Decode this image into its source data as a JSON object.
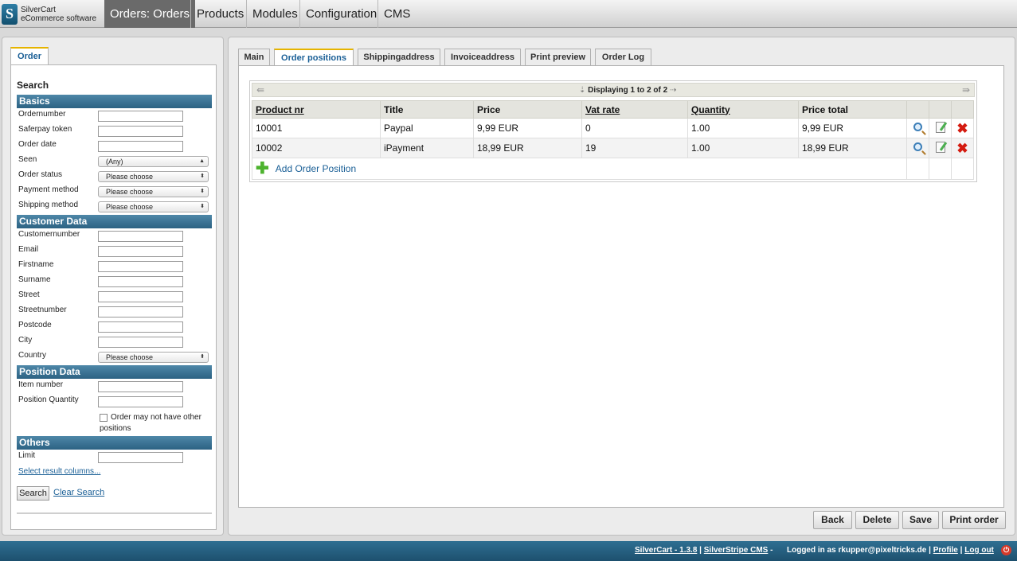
{
  "logo": {
    "line1": "SilverCart",
    "line2": "eCommerce software",
    "mark": "S"
  },
  "nav": [
    {
      "label": "Orders: Orders"
    },
    {
      "label": "Products"
    },
    {
      "label": "Modules"
    },
    {
      "label": "Configuration"
    },
    {
      "label": "CMS"
    }
  ],
  "left": {
    "tab": "Order",
    "search_title": "Search",
    "sections": {
      "basics": "Basics",
      "customer": "Customer Data",
      "position": "Position Data",
      "others": "Others"
    },
    "fields": {
      "ordernumber": "Ordernumber",
      "saferpay": "Saferpay token",
      "order_date": "Order date",
      "seen": "Seen",
      "order_status": "Order status",
      "payment_method": "Payment method",
      "shipping_method": "Shipping method",
      "customernumber": "Customernumber",
      "email": "Email",
      "firstname": "Firstname",
      "surname": "Surname",
      "street": "Street",
      "streetnumber": "Streetnumber",
      "postcode": "Postcode",
      "city": "City",
      "country": "Country",
      "item_number": "Item number",
      "position_quantity": "Position Quantity",
      "limit": "Limit"
    },
    "selects": {
      "seen": "(Any)",
      "order_status": "Please choose",
      "payment_method": "Please choose",
      "shipping_method": "Please choose",
      "country": "Please choose"
    },
    "no_other_positions": "Order may not have other positions",
    "select_columns": "Select result columns...",
    "search_button": "Search",
    "clear_search": "Clear Search"
  },
  "tabs": [
    {
      "label": "Main"
    },
    {
      "label": "Order positions"
    },
    {
      "label": "Shippingaddress"
    },
    {
      "label": "Invoiceaddress"
    },
    {
      "label": "Print preview"
    },
    {
      "label": "Order Log"
    }
  ],
  "pager": {
    "text": "Displaying 1 to 2 of 2"
  },
  "table": {
    "headers": [
      "Product nr",
      "Title",
      "Price",
      "Vat rate",
      "Quantity",
      "Price total"
    ],
    "rows": [
      {
        "product_nr": "10001",
        "title": "Paypal",
        "price": "9,99 EUR",
        "vat": "0",
        "qty": "1.00",
        "total": "9,99 EUR"
      },
      {
        "product_nr": "10002",
        "title": "iPayment",
        "price": "18,99 EUR",
        "vat": "19",
        "qty": "1.00",
        "total": "18,99 EUR"
      }
    ],
    "add_label": "Add Order Position"
  },
  "buttons": {
    "back": "Back",
    "delete": "Delete",
    "save": "Save",
    "print": "Print order"
  },
  "footer": {
    "silvercart": "SilverCart - 1.3.8",
    "sep": "|",
    "silverstripe": "SilverStripe CMS",
    "dash": "-",
    "logged_in": "Logged in as",
    "user": "rkupper@pixeltricks.de",
    "profile": "Profile",
    "logout": "Log out"
  }
}
